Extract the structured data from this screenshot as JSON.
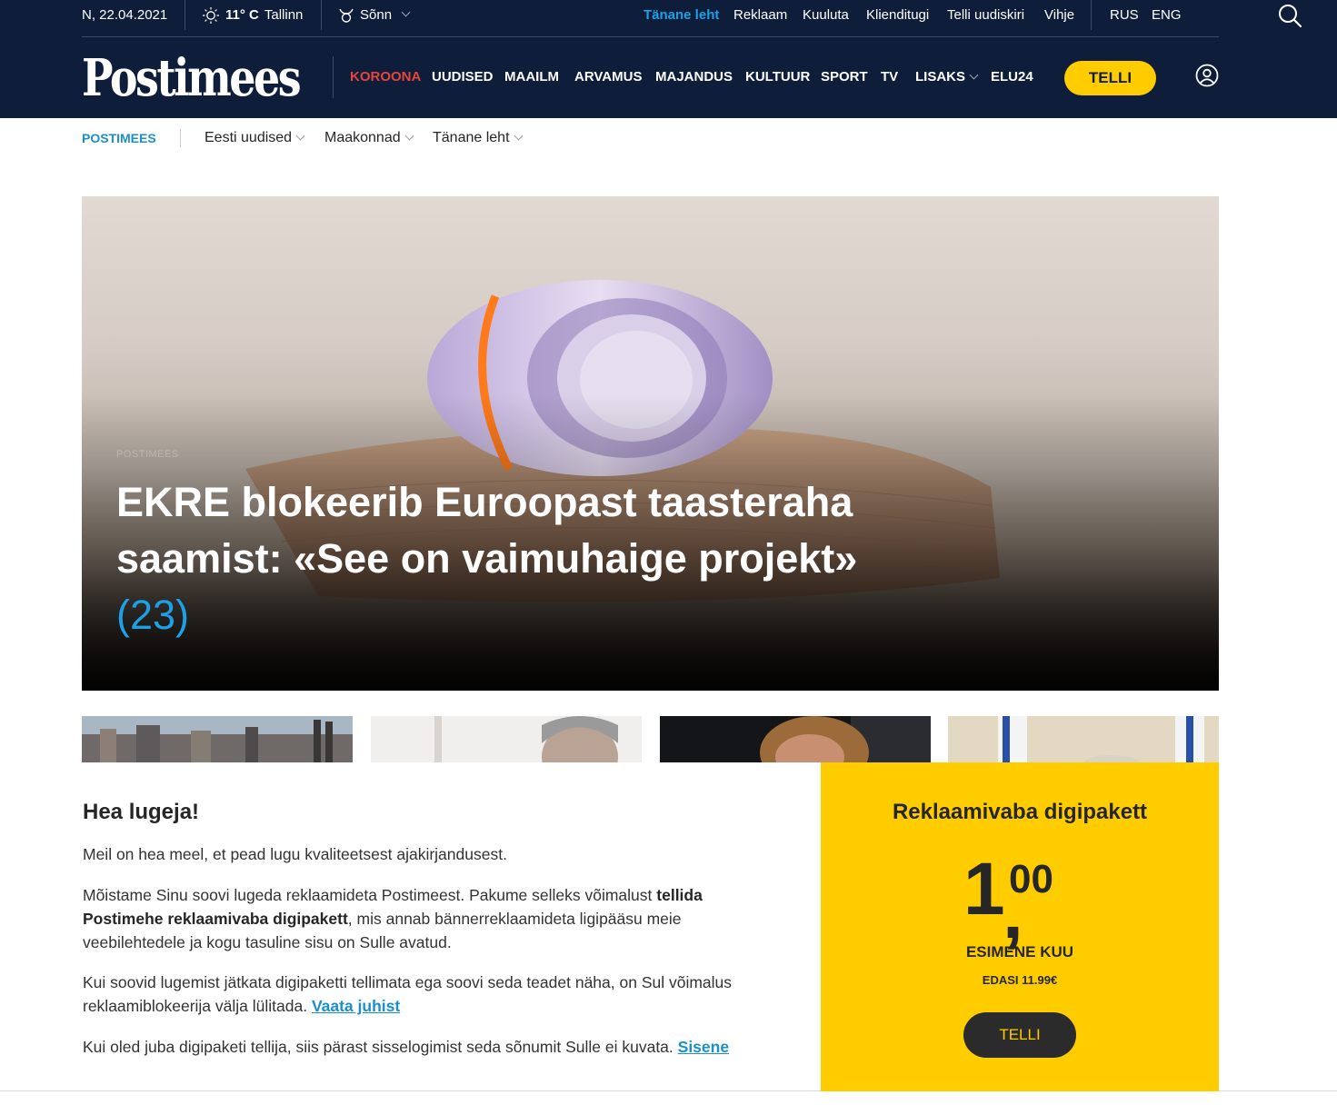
{
  "topbar": {
    "date": "N, 22.04.2021",
    "weather_temp": "11° C",
    "weather_city": "Tallinn",
    "horoscope": "Sõnn",
    "links": [
      "Tänane leht",
      "Reklaam",
      "Kuuluta",
      "Klienditugi",
      "Telli uudiskiri",
      "Vihje"
    ],
    "languages": [
      "RUS",
      "ENG"
    ]
  },
  "brand": {
    "logo": "Postimees"
  },
  "mainnav": [
    "KOROONA",
    "UUDISED",
    "MAAILM",
    "ARVAMUS",
    "MAJANDUS",
    "KULTUUR",
    "SPORT",
    "TV",
    "LISAKS",
    "ELU24"
  ],
  "header_cta": "TELLI",
  "subnav": {
    "brand": "POSTIMEES",
    "items": [
      "Eesti uudised",
      "Maakonnad",
      "Tänane leht"
    ]
  },
  "hero": {
    "kicker": "POSTIMEES",
    "title": "EKRE blokeerib Euroopast taasteraha saamist: «See on vaimuhaige projekt»",
    "comment_count": "(23)"
  },
  "paywall": {
    "title": "Hea lugeja!",
    "p1": "Meil on hea meel, et pead lugu kvaliteetsest ajakirjandusest.",
    "p2_a": "Mõistame Sinu soovi lugeda reklaamideta Postimeest. Pakume selleks võimalust ",
    "p2_b": "tellida Postimehe reklaamivaba digipakett",
    "p2_c": ", mis annab bännerreklaamideta ligipääsu meie veebilehtedele ja kogu tasuline sisu on Sulle avatud.",
    "p3": "Kui soovid lugemist jätkata digipaketti tellimata ega soovi seda teadet näha, on Sul võimalus reklaamiblokeerija välja lülitada. ",
    "p3_link": "Vaata juhist",
    "p4": "Kui oled juba digipaketi tellija, siis pärast sisselogimist seda sõnumit Sulle ei kuvata. ",
    "p4_link": "Sisene"
  },
  "offer": {
    "title": "Reklaamivaba digipakett",
    "price_whole": "1",
    "price_sep": ",",
    "price_cents": "00",
    "period": "ESIMENE KUU",
    "after": "EDASI 11.99€",
    "button": "TELLI"
  },
  "colors": {
    "header_bg": "#0e1e3a",
    "accent_yellow": "#ffcc00",
    "accent_blue": "#1aa1e6",
    "korona_red": "#e8443a"
  }
}
